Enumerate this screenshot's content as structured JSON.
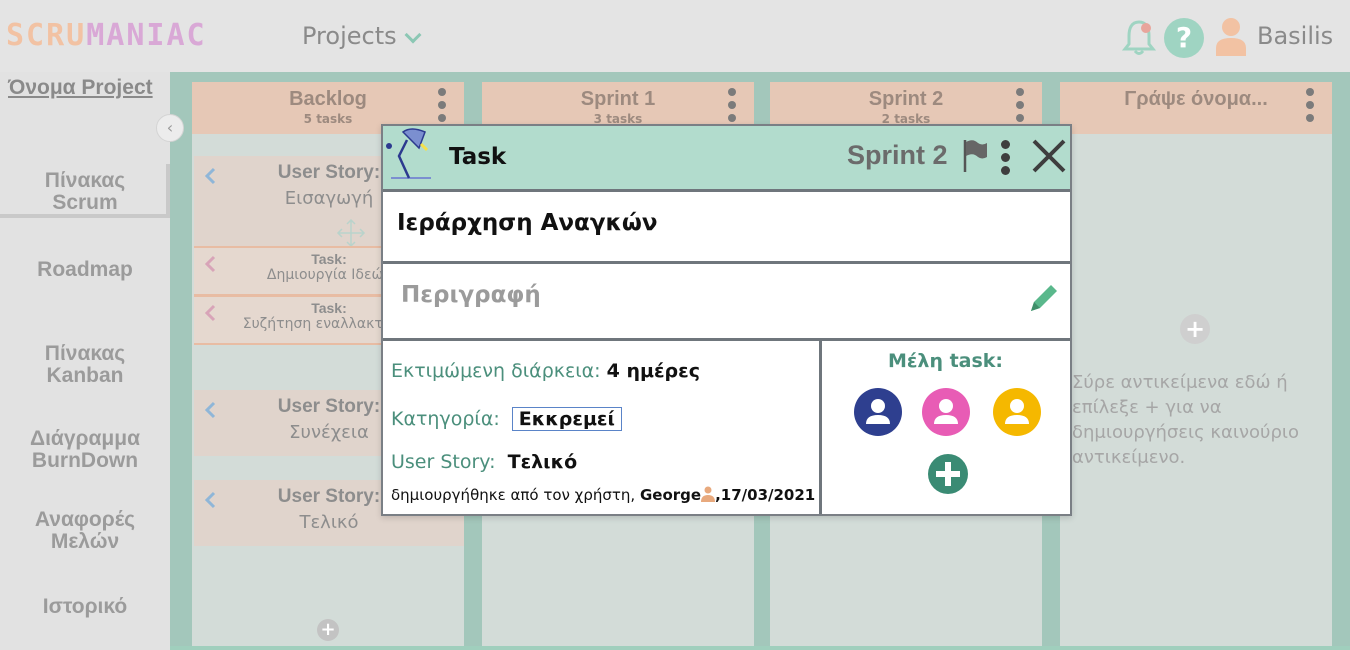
{
  "app": {
    "logo_text": [
      "SCRU",
      "MANIAC"
    ],
    "projects_menu": "Projects",
    "username": "Basilis"
  },
  "sidebar": {
    "project_name": "Όνομα Project",
    "items": [
      {
        "line1": "Πίνακας",
        "line2": "Scrum",
        "active": true
      },
      {
        "line1": "Roadmap",
        "line2": ""
      },
      {
        "line1": "Πίνακας",
        "line2": "Kanban"
      },
      {
        "line1": "Διάγραμμα",
        "line2": "BurnDown"
      },
      {
        "line1": "Αναφορές",
        "line2": "Μελών"
      },
      {
        "line1": "Ιστορικό",
        "line2": ""
      }
    ]
  },
  "board": {
    "columns": [
      {
        "title": "Backlog",
        "subtitle": "5 tasks"
      },
      {
        "title": "Sprint 1",
        "subtitle": "3 tasks"
      },
      {
        "title": "Sprint 2",
        "subtitle": "2 tasks"
      },
      {
        "title": "Γράψε όνομα...",
        "subtitle": ""
      }
    ],
    "backlog_cards": [
      {
        "kind": "User Story:",
        "name": "Εισαγωγή"
      },
      {
        "kind": "Task:",
        "name": "Δημιουργία Ιδεών"
      },
      {
        "kind": "Task:",
        "name": "Συζήτηση εναλλακτικών"
      },
      {
        "kind": "User Story:",
        "name": "Συνέχεια"
      },
      {
        "kind": "User Story:",
        "name": "Τελικό"
      }
    ],
    "empty_hint": "Σύρε αντικείμενα εδώ ή επίλεξε + για να δημιουργήσεις καινούριο αντικείμενο."
  },
  "modal": {
    "type": "Task",
    "sprint": "Sprint 2",
    "title": "Ιεράρχηση Αναγκών",
    "description_placeholder": "Περιγραφή",
    "duration_label": "Εκτιμώμενη διάρκεια:",
    "duration_value": "4 ημέρες",
    "category_label": "Κατηγορία:",
    "category_value": "Εκκρεμεί",
    "story_label": "User Story:",
    "story_value": "Τελικό",
    "created_prefix": "δημιουργήθηκε από τον χρήστη,",
    "created_user": "George",
    "created_date": ",17/03/2021",
    "members_title": "Μέλη task:",
    "members": [
      {
        "color": "#2e3f8f"
      },
      {
        "color": "#e85cb5"
      },
      {
        "color": "#f5b800"
      }
    ]
  },
  "colors": {
    "accent": "#4b8f7c",
    "modal_header": "#b2dccd",
    "column_header": "#e6c8b6"
  }
}
